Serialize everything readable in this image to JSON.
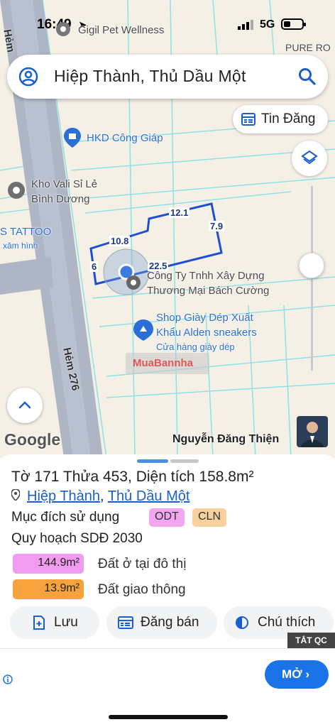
{
  "status_bar": {
    "time": "16:49",
    "network": "5G"
  },
  "search": {
    "text": "Hiệp Thành, Thủ Dầu Một"
  },
  "map": {
    "pois": {
      "top_poi": "Gigil Pet Wellness",
      "pure_ro": "PURE RO",
      "hkd": "HKD Công Giáp",
      "kho_line1": "Kho Vali Sỉ Lẻ",
      "kho_line2": "Bình Dương",
      "tattoo": "S TATTOO",
      "tattoo_sub": "xăm hình",
      "company_line1": "Công Ty Tnhh Xây Dựng",
      "company_line2": "Thương Mại Bách Cường",
      "shop_line1": "Shop Giày Dép Xuất",
      "shop_line2": "Khẩu Alden sneakers",
      "shop_sub": "Cửa hàng giày dép"
    },
    "roads": {
      "hem": "Hẻm",
      "hem276": "Hẻm 276"
    },
    "dimensions": {
      "top": "12.1",
      "right": "7.9",
      "left_top": "10.8",
      "bottom": "22.5",
      "left": "6"
    },
    "watermark": "MuaBannha",
    "attribution": "Google",
    "owner": "Nguyễn Đăng Thiện",
    "buttons": {
      "tin_dang": "Tin Đăng"
    }
  },
  "sheet": {
    "parcel_text": "Tờ 171 Thửa 453, Diện tích 158.8m²",
    "location": {
      "ward": "Hiệp Thành",
      "separator": ", ",
      "city": "Thủ Dầu Một"
    },
    "muc_dich_label": "Mục đích sử dụng",
    "badges": [
      "ODT",
      "CLN"
    ],
    "quy_hoach": "Quy hoạch SDĐ 2030",
    "legend": [
      {
        "value": "144.9m²",
        "label": "Đất ở tại đô thị",
        "color": "#f29cf0"
      },
      {
        "value": "13.9m²",
        "label": "Đất giao thông",
        "color": "#f7a23c"
      }
    ],
    "actions": {
      "save": "Lưu",
      "sell": "Đăng bán",
      "legend": "Chú thích"
    }
  },
  "ad": {
    "close_label": "TẮT QC",
    "open_label": "MỞ"
  }
}
